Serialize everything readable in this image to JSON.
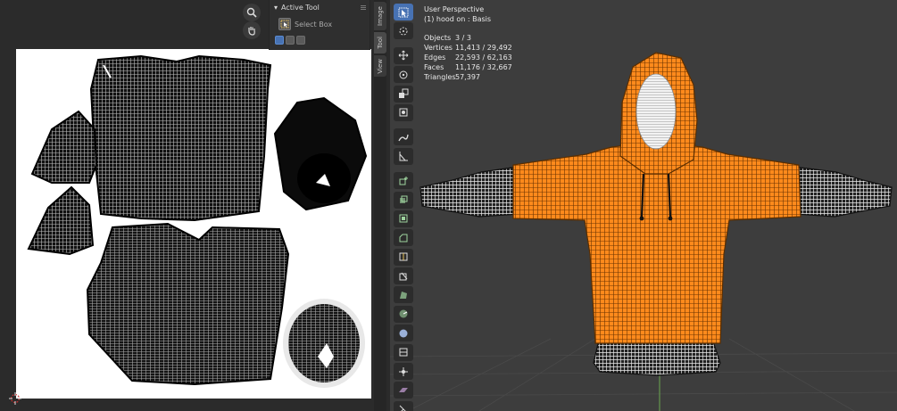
{
  "uv_editor": {
    "side_tabs": [
      "Image",
      "Tool",
      "View"
    ],
    "active_tool": {
      "header": "Active Tool",
      "tool_label": "Select Box"
    },
    "gizmo_icons": [
      "zoom-icon",
      "hand-pan-icon"
    ]
  },
  "viewport": {
    "view_name": "User Perspective",
    "object_info": "(1) hood on : Basis",
    "stats": [
      {
        "label": "Objects",
        "value": "3 / 3"
      },
      {
        "label": "Vertices",
        "value": "11,413 / 29,492"
      },
      {
        "label": "Edges",
        "value": "22,593 / 62,163"
      },
      {
        "label": "Faces",
        "value": "11,176 / 32,667"
      },
      {
        "label": "Triangles",
        "value": "57,397"
      }
    ],
    "toolbar_icons": [
      "select-box-icon",
      "cursor-icon",
      "move-icon",
      "rotate-icon",
      "scale-icon",
      "transform-icon",
      "annotate-icon",
      "measure-icon",
      "add-cube-icon",
      "extrude-icon",
      "inset-icon",
      "bevel-icon",
      "loop-cut-icon",
      "knife-icon",
      "poly-build-icon",
      "spin-icon",
      "smooth-icon",
      "edge-slide-icon",
      "shrink-fatten-icon",
      "shear-icon",
      "rip-icon"
    ]
  },
  "colors": {
    "selected_orange": "#ff8a1c",
    "active_blue": "#4772b3",
    "viewport_bg": "#3d3d3d",
    "uv_bg": "#ffffff"
  }
}
